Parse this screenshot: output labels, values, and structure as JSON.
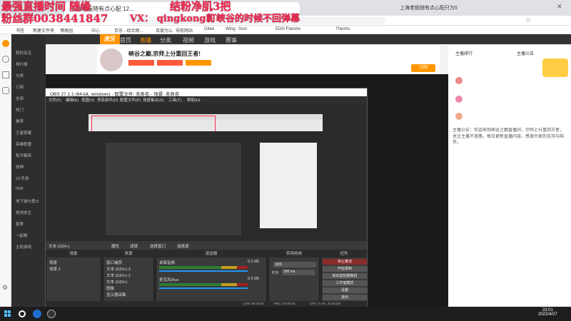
{
  "overlay": {
    "line1": "最强直播时间 随缘",
    "line2": "粉丝群0038441847",
    "wechat": "VX： qingkongli",
    "fans": "结粉净肌3把",
    "notice": "打峡谷的时候不回弹幕"
  },
  "browser": {
    "tab_title": "上海老板随有点心配 12...",
    "right_tab": "上海老板随有点心配只为5"
  },
  "bookmarks": [
    "书签",
    "新建文件夹",
    "博客园",
    "中心",
    "京东 - 综合网...",
    "百度为么",
    "导航网站",
    "Gitee",
    "Wing",
    "Sum",
    "EDG Flandre",
    "Thesho"
  ],
  "site": {
    "logo": "虎牙",
    "nav": [
      "首页",
      "直播",
      "分类",
      "视频",
      "游戏",
      "赛事"
    ],
    "stream_title": "峡谷之巅,宗师上分重回王者!",
    "follow_label": "订阅",
    "sidebar": [
      "我的关注",
      "排行榜",
      "分类",
      "订阅",
      "全部",
      "热门",
      "推荐",
      "王者荣耀",
      "英雄联盟",
      "和平精英",
      "原神",
      "CF手游",
      "DNF",
      "地下城与勇士",
      "绝地求生",
      "星秀",
      "一起看",
      "主机游戏"
    ],
    "right_panel": {
      "title": "主播排行",
      "announce_title": "主播公告",
      "announce_text": "主播公告：欢迎来到峡谷之巅直播间，宗师上分重回王者，关注主播不迷路，每日更新直播内容，感谢大家的支持与陪伴。"
    }
  },
  "obs": {
    "title": "OBS 27.1.1 (64-bit, windows) - 配置文件: 未命名 - 场景: 未命名",
    "menu": [
      "文件(F)",
      "编辑(E)",
      "视图(V)",
      "停靠部件(D)",
      "配置文件(P)",
      "场景集合(S)",
      "工具(T)",
      "帮助(H)"
    ],
    "source_label": "文本 (GDI+)",
    "prop_btn": "属性",
    "filter_btn": "滤镜",
    "select_window": "选择窗口",
    "select_source": "选择源",
    "docks": {
      "scenes": "场景",
      "sources": "来源",
      "mixer": "混音器",
      "transitions": "转场特效",
      "controls": "控件"
    },
    "scenes": [
      "场景",
      "场景 2"
    ],
    "sources": [
      "窗口捕获",
      "文本 (GDI+) 3",
      "文本 (GDI+) 2",
      "文本 (GDI+)",
      "图像",
      "显示器采集"
    ],
    "mixer": [
      {
        "name": "桌面音频",
        "db": "0.0 dB"
      },
      {
        "name": "麦克风/Aux",
        "db": "0.0 dB"
      }
    ],
    "transition": {
      "type": "淡出",
      "duration_label": "时长",
      "duration": "300 ms"
    },
    "controls": [
      "停止推流",
      "开始录制",
      "启动虚拟摄像机",
      "工作室模式",
      "设置",
      "退出"
    ],
    "status": {
      "live": "LIVE: 00:00:00",
      "rec": "REC: 00:00:00",
      "cpu": "CPU: 0.1%, 30.00 fps"
    }
  },
  "taskbar": {
    "time": "23:01",
    "date": "2022/4/27"
  },
  "colors": {
    "overlay": "#ff2a55",
    "huya_orange": "#ff9600",
    "obs_bg": "#2b2b2b",
    "stop_stream": "#8a2b2b"
  },
  "icons": [
    "back-icon",
    "forward-icon",
    "refresh-icon",
    "star-icon",
    "windows-icon",
    "search-icon",
    "obs-icon",
    "settings-icon"
  ]
}
